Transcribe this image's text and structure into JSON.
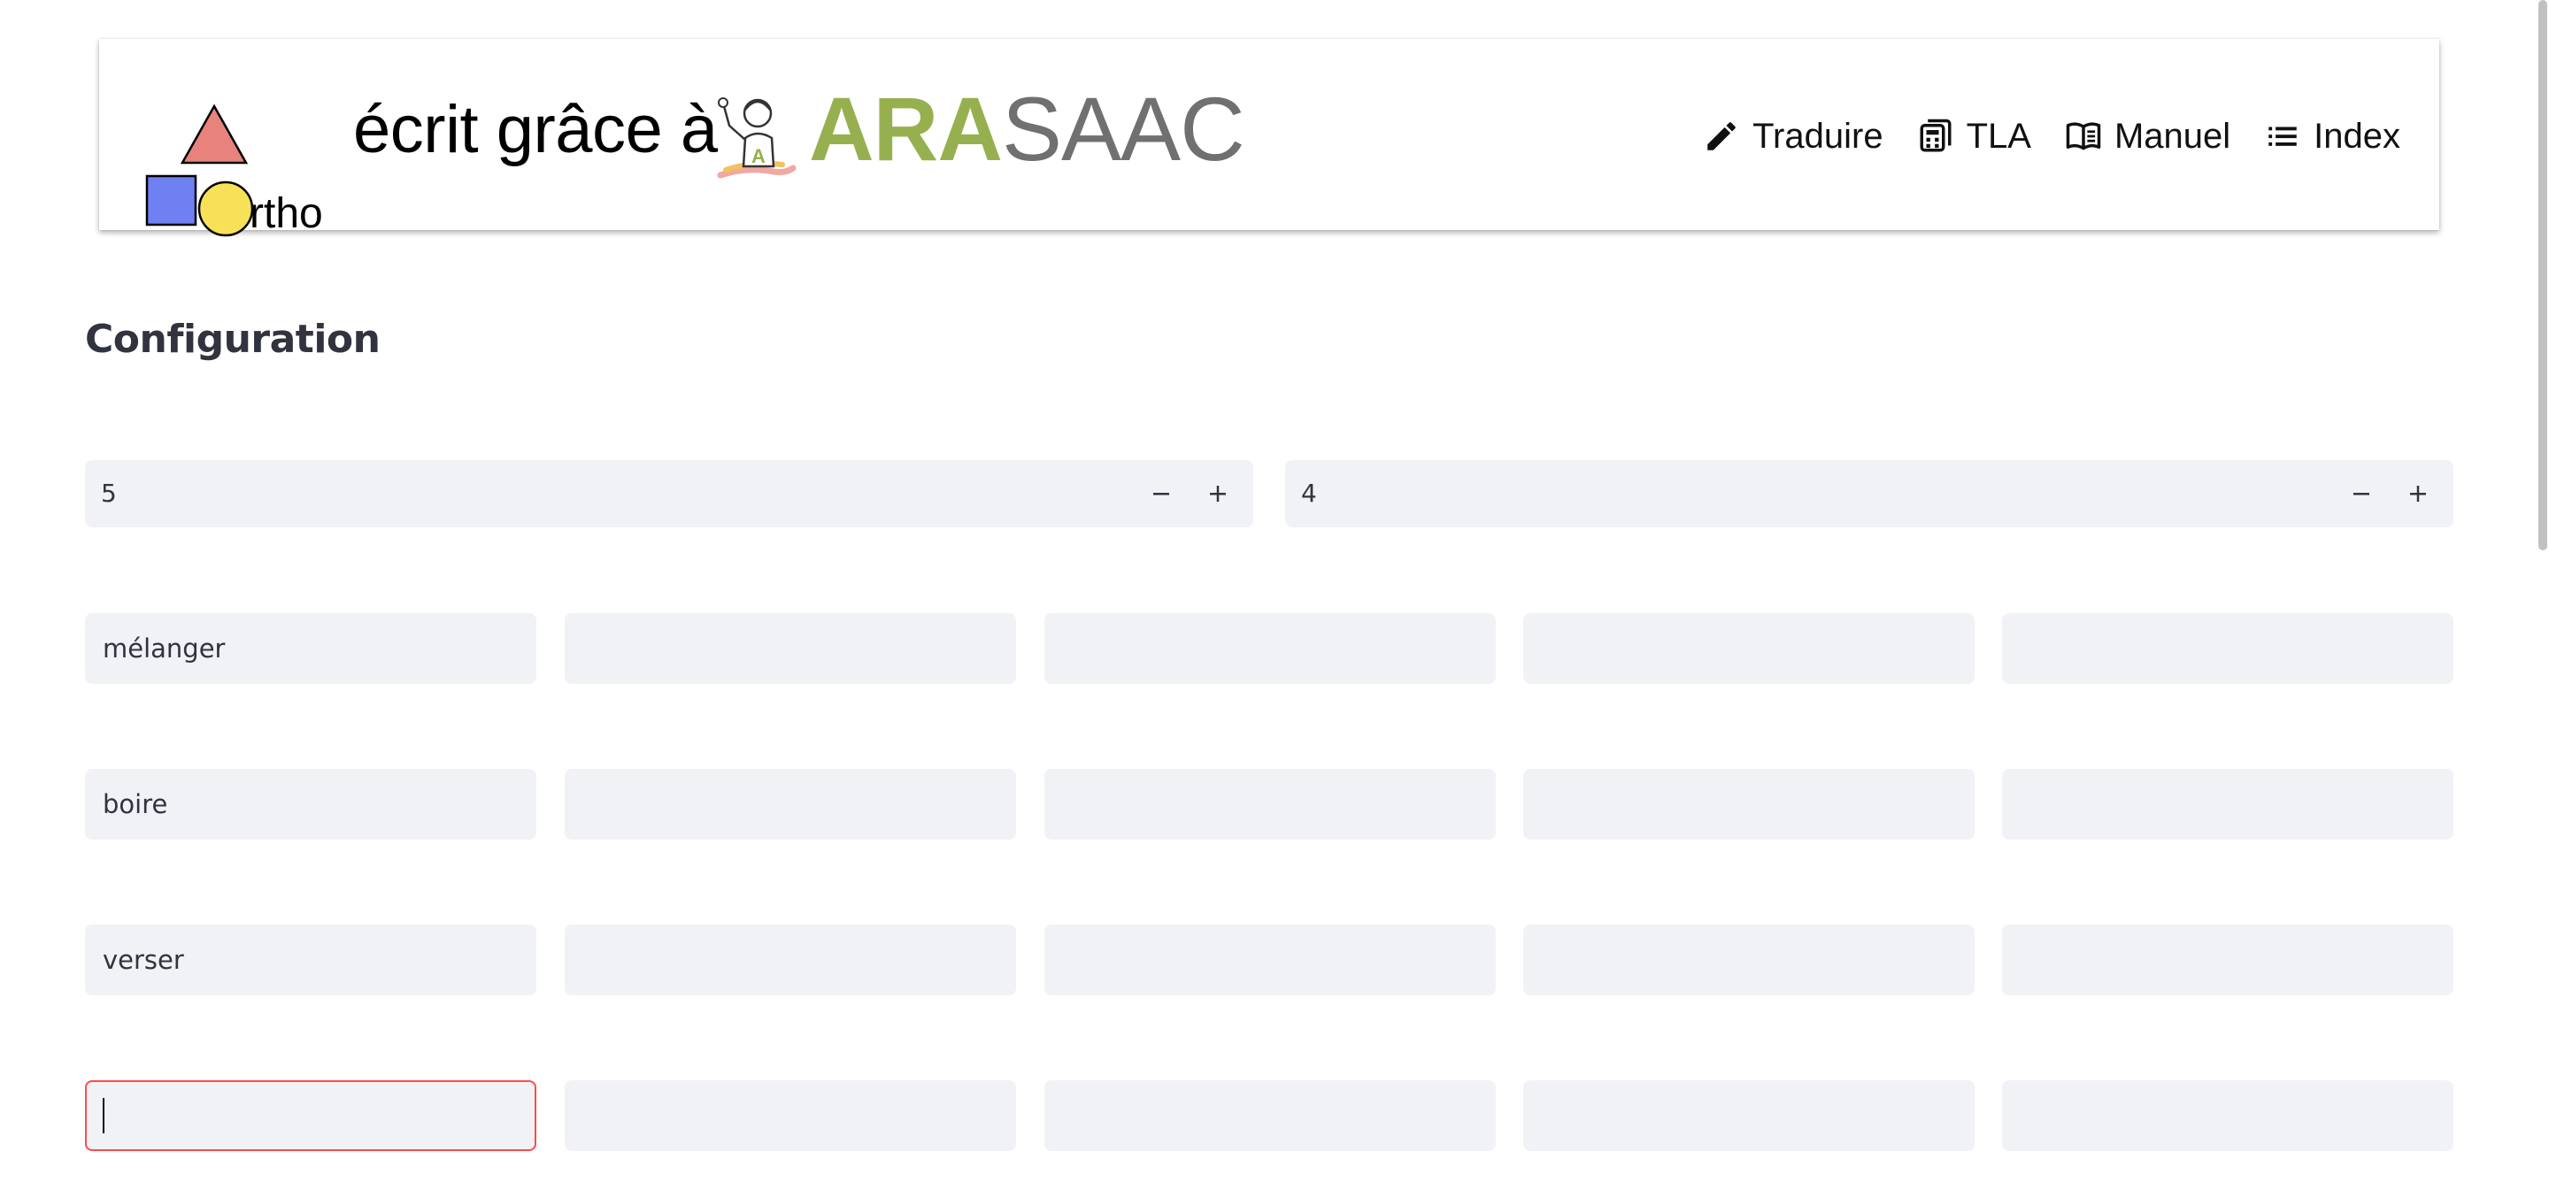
{
  "header": {
    "logo_text": "rtho",
    "tagline": "écrit grâce à",
    "brand": {
      "part1": "ARA",
      "part2": "SAAC"
    },
    "nav": [
      {
        "label": "Traduire",
        "icon": "pencil-icon"
      },
      {
        "label": "TLA",
        "icon": "calculator-icon"
      },
      {
        "label": "Manuel",
        "icon": "book-icon"
      },
      {
        "label": "Index",
        "icon": "list-icon"
      }
    ]
  },
  "main": {
    "title": "Configuration",
    "steppers": [
      {
        "value": "5"
      },
      {
        "value": "4"
      }
    ],
    "grid": [
      [
        "mélanger",
        "",
        "",
        "",
        ""
      ],
      [
        "boire",
        "",
        "",
        "",
        ""
      ],
      [
        "verser",
        "",
        "",
        "",
        ""
      ],
      [
        "",
        "",
        "",
        "",
        ""
      ]
    ]
  },
  "colors": {
    "accent_focus": "#ff4b4b",
    "field_bg": "#f0f2f6",
    "brand_green": "#97b04f",
    "brand_grey": "#707070",
    "logo_triangle": "#e8827c",
    "logo_square": "#6f80f2",
    "logo_circle": "#f7e157"
  }
}
